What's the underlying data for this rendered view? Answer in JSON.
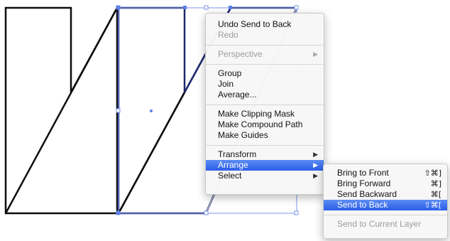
{
  "context_menu": {
    "items": [
      {
        "label": "Undo Send to Back",
        "enabled": true
      },
      {
        "label": "Redo",
        "enabled": false
      },
      {
        "label": "Perspective",
        "enabled": false,
        "has_submenu": true
      },
      {
        "label": "Group",
        "enabled": true
      },
      {
        "label": "Join",
        "enabled": true
      },
      {
        "label": "Average...",
        "enabled": true
      },
      {
        "label": "Make Clipping Mask",
        "enabled": true
      },
      {
        "label": "Make Compound Path",
        "enabled": true
      },
      {
        "label": "Make Guides",
        "enabled": true
      },
      {
        "label": "Transform",
        "enabled": true,
        "has_submenu": true
      },
      {
        "label": "Arrange",
        "enabled": true,
        "has_submenu": true,
        "highlighted": true
      },
      {
        "label": "Select",
        "enabled": true,
        "has_submenu": true
      }
    ]
  },
  "arrange_submenu": {
    "items": [
      {
        "label": "Bring to Front",
        "shortcut": "⇧⌘]",
        "enabled": true
      },
      {
        "label": "Bring Forward",
        "shortcut": "⌘]",
        "enabled": true
      },
      {
        "label": "Send Backward",
        "shortcut": "⌘[",
        "enabled": true
      },
      {
        "label": "Send to Back",
        "shortcut": "⇧⌘[",
        "enabled": true,
        "highlighted": true
      },
      {
        "label": "Send to Current Layer",
        "enabled": false
      }
    ]
  },
  "icons": {
    "submenu_arrow": "▶"
  },
  "colors": {
    "highlight": "#2f62e9",
    "selection": "#5b7fe8",
    "shape_stroke": "#0d0d0d",
    "selected_stroke": "#1d2a6e"
  }
}
